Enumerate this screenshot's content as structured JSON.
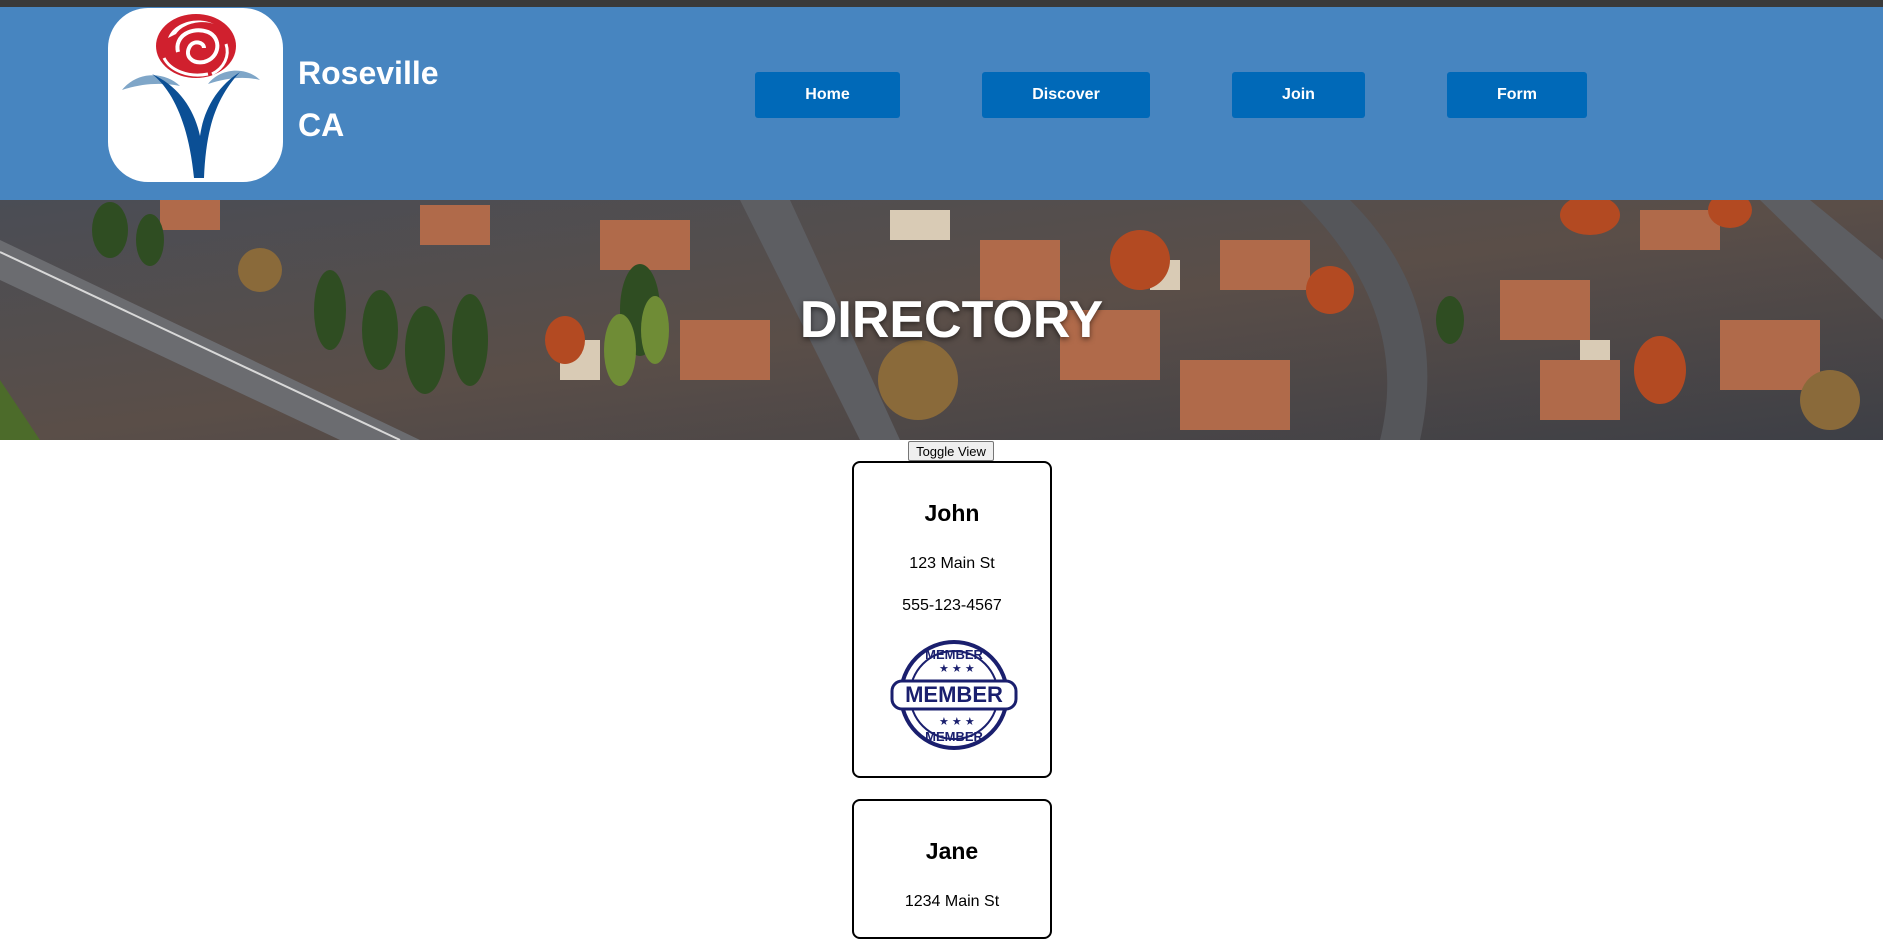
{
  "site": {
    "name_line1": "Roseville",
    "name_line2": "CA",
    "logo_icon": "rose-logo-icon"
  },
  "nav": {
    "items": [
      {
        "label": "Home"
      },
      {
        "label": "Discover"
      },
      {
        "label": "Join"
      },
      {
        "label": "Form"
      }
    ]
  },
  "hero": {
    "title": "DIRECTORY",
    "background": "aerial-neighborhood-photo"
  },
  "toggle": {
    "label": "Toggle View"
  },
  "directory": {
    "cards": [
      {
        "name": "John",
        "address": "123 Main St",
        "phone": "555-123-4567",
        "badge": {
          "icon": "member-stamp-icon",
          "text": "MEMBER"
        }
      },
      {
        "name": "Jane",
        "address": "1234 Main St"
      }
    ]
  },
  "colors": {
    "header_bg": "#4785c0",
    "nav_button": "#0069b8",
    "logo_red": "#d0202e",
    "logo_blue": "#0b4f95",
    "stamp_navy": "#1a1f6e"
  }
}
